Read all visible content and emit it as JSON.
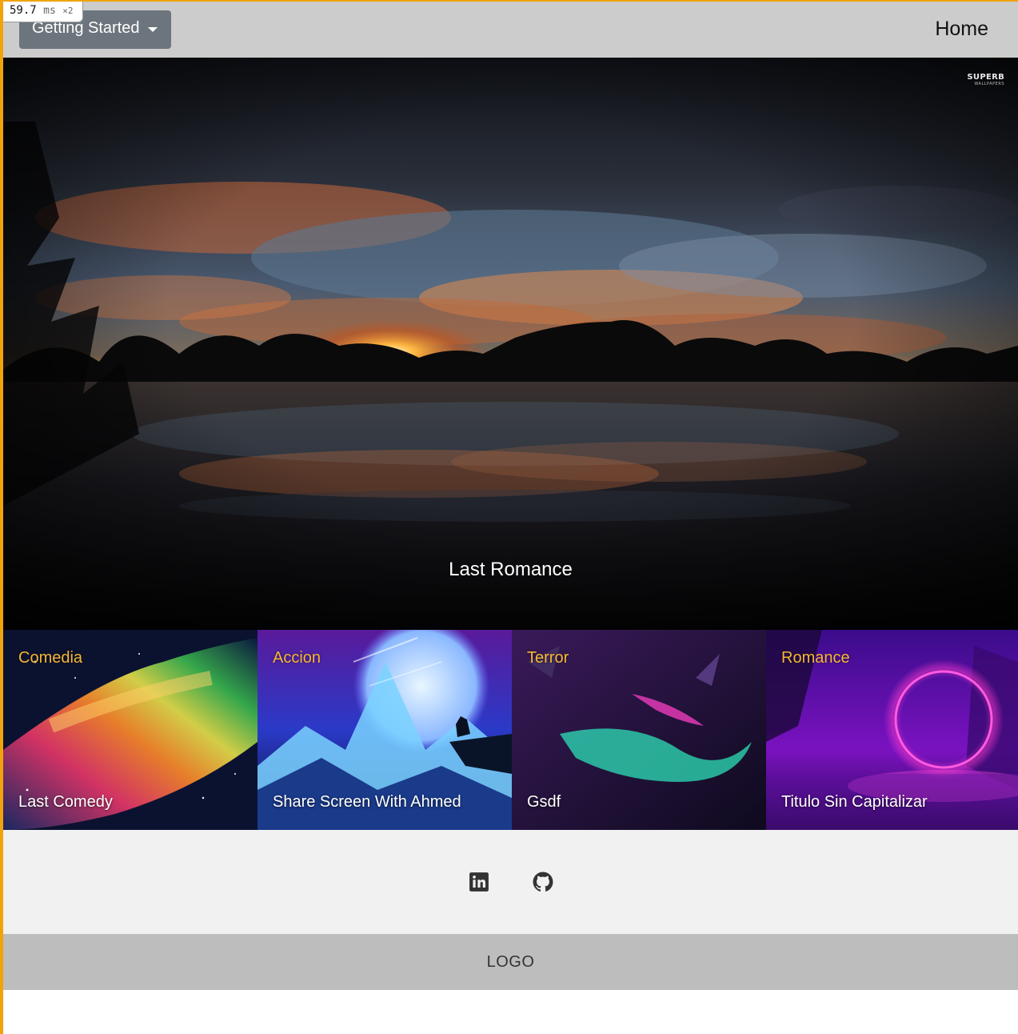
{
  "perf": {
    "value": "59.7",
    "unit": "ms",
    "multiplier": "×2"
  },
  "navbar": {
    "dropdown_label": "Getting Started",
    "home_label": "Home"
  },
  "hero": {
    "watermark_top": "SUPERB",
    "watermark_bottom": "WALLPAPERS",
    "caption": "Last Romance"
  },
  "cards": [
    {
      "genre": "Comedia",
      "title": "Last Comedy"
    },
    {
      "genre": "Accion",
      "title": "Share Screen With Ahmed"
    },
    {
      "genre": "Terror",
      "title": "Gsdf"
    },
    {
      "genre": "Romance",
      "title": "Titulo Sin Capitalizar"
    }
  ],
  "social": {
    "linkedin_icon": "linkedin-icon",
    "github_icon": "github-icon"
  },
  "footer": {
    "logo": "LOGO"
  },
  "colors": {
    "navbar_bg": "#cccccc",
    "dropdown_bg": "#6c757d",
    "genre_accent": "#f5b731",
    "social_bg": "#f1f1f1",
    "footer_bg": "#bdbdbd",
    "frame_accent": "#f0a30a"
  }
}
